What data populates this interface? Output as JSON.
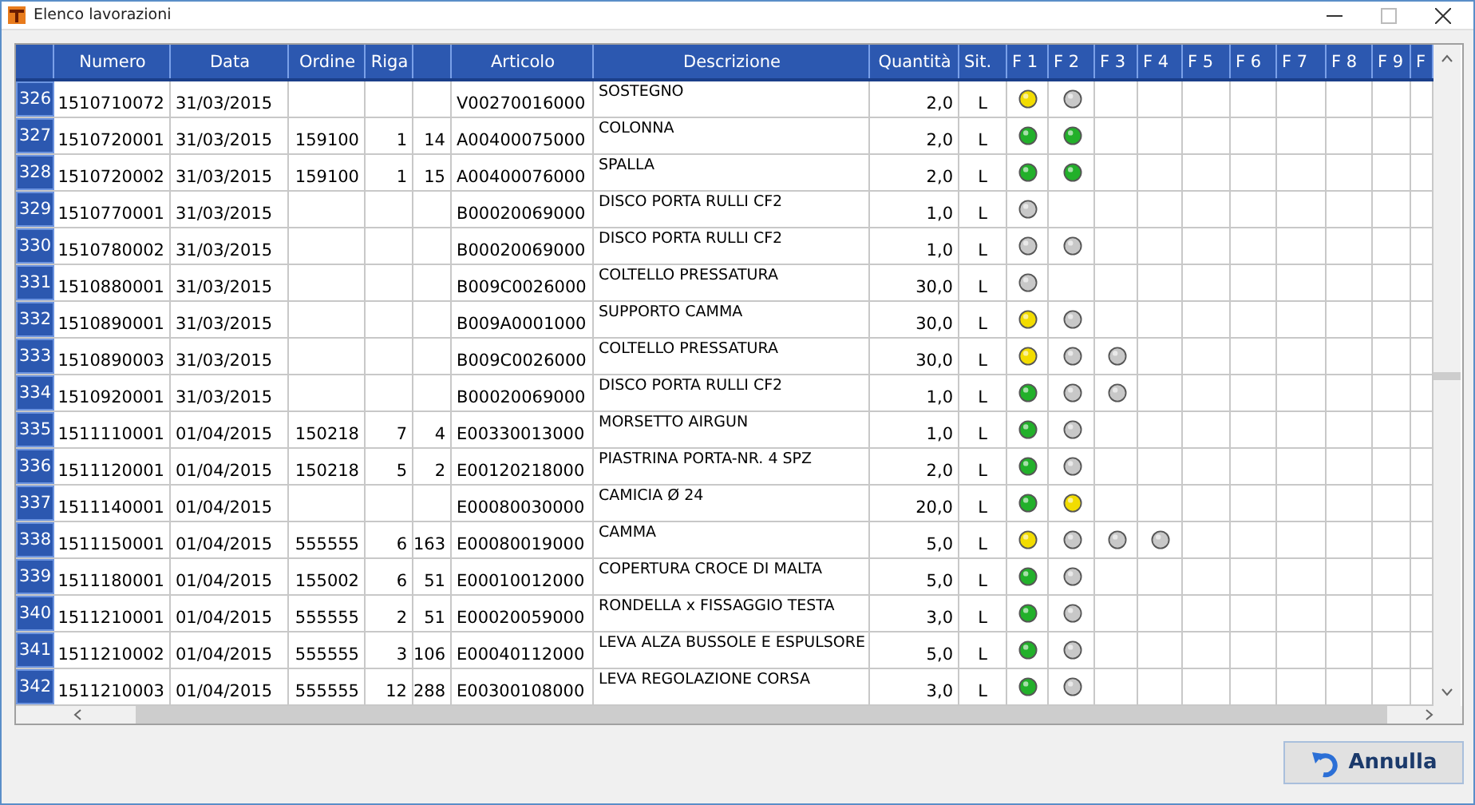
{
  "window": {
    "title": "Elenco lavorazioni"
  },
  "columns": [
    "Numero",
    "Data",
    "Ordine",
    "Riga",
    "Articolo",
    "Descrizione",
    "Quantità",
    "Sit.",
    "F 1",
    "F 2",
    "F 3",
    "F 4",
    "F 5",
    "F 6",
    "F 7",
    "F 8",
    "F 9",
    "F"
  ],
  "rows": [
    {
      "index": "326",
      "numero": "1510710072",
      "data": "31/03/2015",
      "articolo": "V00270016000",
      "descrizione": "SOSTEGNO",
      "quantita": "2,0",
      "sit": "L",
      "lights": [
        {
          "color": "#f2dc00"
        },
        {
          "color": "#c8c8c8"
        }
      ]
    },
    {
      "index": "327",
      "numero": "1510720001",
      "data": "31/03/2015",
      "ordine": "159100",
      "riga": "1",
      "column_5": "14",
      "articolo": "A00400075000",
      "descrizione": "COLONNA",
      "quantita": "2,0",
      "sit": "L",
      "lights": [
        {
          "color": "#22b02a"
        },
        {
          "color": "#22b02a"
        }
      ]
    },
    {
      "index": "328",
      "numero": "1510720002",
      "data": "31/03/2015",
      "ordine": "159100",
      "riga": "1",
      "column_5": "15",
      "articolo": "A00400076000",
      "descrizione": "SPALLA",
      "quantita": "2,0",
      "sit": "L",
      "lights": [
        {
          "color": "#22b02a"
        },
        {
          "color": "#22b02a"
        }
      ]
    },
    {
      "index": "329",
      "numero": "1510770001",
      "data": "31/03/2015",
      "articolo": "B00020069000",
      "descrizione": "DISCO PORTA RULLI  CF2",
      "quantita": "1,0",
      "sit": "L",
      "lights": [
        {
          "color": "#c8c8c8"
        }
      ]
    },
    {
      "index": "330",
      "numero": "1510780002",
      "data": "31/03/2015",
      "articolo": "B00020069000",
      "descrizione": "DISCO PORTA RULLI  CF2",
      "quantita": "1,0",
      "sit": "L",
      "lights": [
        {
          "color": "#c8c8c8"
        },
        {
          "color": "#c8c8c8"
        }
      ]
    },
    {
      "index": "331",
      "numero": "1510880001",
      "data": "31/03/2015",
      "articolo": "B009C0026000",
      "descrizione": "COLTELLO PRESSATURA",
      "quantita": "30,0",
      "sit": "L",
      "lights": [
        {
          "color": "#c8c8c8"
        }
      ]
    },
    {
      "index": "332",
      "numero": "1510890001",
      "data": "31/03/2015",
      "articolo": "B009A0001000",
      "descrizione": "SUPPORTO CAMMA",
      "quantita": "30,0",
      "sit": "L",
      "lights": [
        {
          "color": "#f2dc00"
        },
        {
          "color": "#c8c8c8"
        }
      ]
    },
    {
      "index": "333",
      "numero": "1510890003",
      "data": "31/03/2015",
      "articolo": "B009C0026000",
      "descrizione": "COLTELLO PRESSATURA",
      "quantita": "30,0",
      "sit": "L",
      "lights": [
        {
          "color": "#f2dc00"
        },
        {
          "color": "#c8c8c8"
        },
        {
          "color": "#c8c8c8"
        }
      ]
    },
    {
      "index": "334",
      "numero": "1510920001",
      "data": "31/03/2015",
      "articolo": "B00020069000",
      "descrizione": "DISCO PORTA RULLI  CF2",
      "quantita": "1,0",
      "sit": "L",
      "lights": [
        {
          "color": "#22b02a"
        },
        {
          "color": "#c8c8c8"
        },
        {
          "color": "#c8c8c8"
        }
      ]
    },
    {
      "index": "335",
      "numero": "1511110001",
      "data": "01/04/2015",
      "ordine": "150218",
      "riga": "7",
      "column_5": "4",
      "articolo": "E00330013000",
      "descrizione": "MORSETTO AIRGUN",
      "quantita": "1,0",
      "sit": "L",
      "lights": [
        {
          "color": "#22b02a"
        },
        {
          "color": "#c8c8c8"
        }
      ]
    },
    {
      "index": "336",
      "numero": "1511120001",
      "data": "01/04/2015",
      "ordine": "150218",
      "riga": "5",
      "column_5": "2",
      "articolo": "E00120218000",
      "descrizione": "PIASTRINA PORTA-NR. 4 SPZ",
      "quantita": "2,0",
      "sit": "L",
      "lights": [
        {
          "color": "#22b02a"
        },
        {
          "color": "#c8c8c8"
        }
      ]
    },
    {
      "index": "337",
      "numero": "1511140001",
      "data": "01/04/2015",
      "articolo": "E00080030000",
      "descrizione": "CAMICIA Ø 24",
      "quantita": "20,0",
      "sit": "L",
      "lights": [
        {
          "color": "#22b02a"
        },
        {
          "color": "#f2dc00"
        }
      ]
    },
    {
      "index": "338",
      "numero": "1511150001",
      "data": "01/04/2015",
      "ordine": "555555",
      "riga": "6",
      "column_5": "163",
      "articolo": "E00080019000",
      "descrizione": "CAMMA",
      "quantita": "5,0",
      "sit": "L",
      "lights": [
        {
          "color": "#f2dc00"
        },
        {
          "color": "#c8c8c8"
        },
        {
          "color": "#c8c8c8"
        },
        {
          "color": "#c8c8c8"
        }
      ]
    },
    {
      "index": "339",
      "numero": "1511180001",
      "data": "01/04/2015",
      "ordine": "155002",
      "riga": "6",
      "column_5": "51",
      "articolo": "E00010012000",
      "descrizione": "COPERTURA CROCE DI MALTA",
      "quantita": "5,0",
      "sit": "L",
      "lights": [
        {
          "color": "#22b02a"
        },
        {
          "color": "#c8c8c8"
        }
      ]
    },
    {
      "index": "340",
      "numero": "1511210001",
      "data": "01/04/2015",
      "ordine": "555555",
      "riga": "2",
      "column_5": "51",
      "articolo": "E00020059000",
      "descrizione": "RONDELLA x FISSAGGIO TESTA",
      "quantita": "3,0",
      "sit": "L",
      "lights": [
        {
          "color": "#22b02a"
        },
        {
          "color": "#c8c8c8"
        }
      ]
    },
    {
      "index": "341",
      "numero": "1511210002",
      "data": "01/04/2015",
      "ordine": "555555",
      "riga": "3",
      "column_5": "106",
      "articolo": "E00040112000",
      "descrizione": "LEVA ALZA BUSSOLE E ESPULSORE",
      "quantita": "5,0",
      "sit": "L",
      "lights": [
        {
          "color": "#22b02a"
        },
        {
          "color": "#c8c8c8"
        }
      ]
    },
    {
      "index": "342",
      "numero": "1511210003",
      "data": "01/04/2015",
      "ordine": "555555",
      "riga": "12",
      "column_5": "288",
      "articolo": "E00300108000",
      "descrizione": "LEVA REGOLAZIONE CORSA",
      "quantita": "3,0",
      "sit": "L",
      "lights": [
        {
          "color": "#22b02a"
        },
        {
          "color": "#c8c8c8"
        }
      ]
    }
  ],
  "buttons": [
    {
      "label": "Annulla"
    }
  ]
}
